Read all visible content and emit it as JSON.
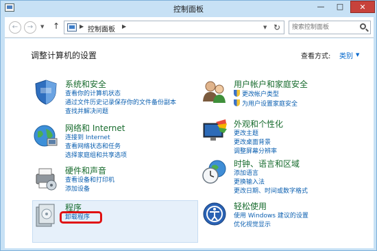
{
  "window": {
    "title": "控制面板",
    "minimize": "—",
    "maximize": "□",
    "close": "✕"
  },
  "nav": {
    "back": "←",
    "forward": "→",
    "up": "↑",
    "breadcrumb": "控制面板",
    "search_placeholder": "搜索控制面板"
  },
  "content": {
    "heading": "调整计算机的设置",
    "view_by_label": "查看方式:",
    "view_by_value": "类别"
  },
  "categories_left": [
    {
      "title": "系统和安全",
      "links": [
        "查看你的计算机状态",
        "通过文件历史记录保存你的文件备份副本",
        "查找并解决问题"
      ]
    },
    {
      "title": "网络和 Internet",
      "links": [
        "连接到 Internet",
        "查看网络状态和任务",
        "选择家庭组和共享选项"
      ]
    },
    {
      "title": "硬件和声音",
      "links": [
        "查看设备和打印机",
        "添加设备"
      ]
    },
    {
      "title": "程序",
      "links": [
        "卸载程序"
      ]
    }
  ],
  "categories_right": [
    {
      "title": "用户帐户和家庭安全",
      "links": [
        "更改帐户类型",
        "为用户设置家庭安全"
      ]
    },
    {
      "title": "外观和个性化",
      "links": [
        "更改主题",
        "更改桌面背景",
        "调整屏幕分辨率"
      ]
    },
    {
      "title": "时钟、语言和区域",
      "links": [
        "添加语言",
        "更换输入法",
        "更改日期、时间或数字格式"
      ]
    },
    {
      "title": "轻松使用",
      "links": [
        "使用 Windows 建议的设置",
        "优化视觉显示"
      ]
    }
  ],
  "colors": {
    "link": "#0b5fb0",
    "category_title": "#176b2d",
    "highlight_box": "#e01010",
    "frame": "#c7e1f5"
  }
}
